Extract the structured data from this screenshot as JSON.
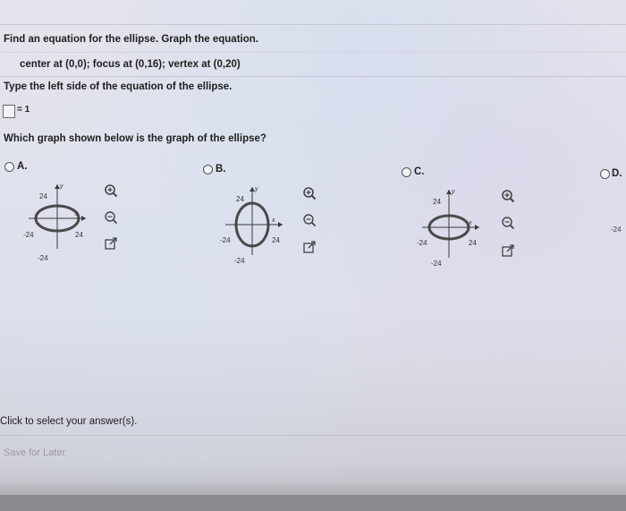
{
  "question": {
    "prompt": "Find an equation for the ellipse. Graph the equation.",
    "given": "center at (0,0); focus at (0,16); vertex at (0,20)",
    "instruction": "Type the left side of the equation of the ellipse.",
    "equation_suffix": "= 1",
    "graph_question": "Which graph shown below is the graph of the ellipse?"
  },
  "options": [
    {
      "letter": "A.",
      "orientation": "horizontal-wide",
      "tick_top": "24",
      "tick_left": "-24",
      "tick_right": "24",
      "tick_bottom": "-24",
      "axis_x": "x",
      "axis_y": "y"
    },
    {
      "letter": "B.",
      "orientation": "vertical",
      "tick_top": "24",
      "tick_left": "-24",
      "tick_right": "24",
      "tick_bottom": "-24",
      "axis_x": "x",
      "axis_y": "y"
    },
    {
      "letter": "C.",
      "orientation": "horizontal",
      "tick_top": "24",
      "tick_left": "-24",
      "tick_right": "24",
      "tick_bottom": "-24",
      "axis_x": "x",
      "axis_y": "y"
    },
    {
      "letter": "D.",
      "tick_right": "-24"
    }
  ],
  "tools": {
    "zoom_in": "magnifier-plus-icon",
    "zoom_out": "magnifier-minus-icon",
    "open": "external-link-icon"
  },
  "footer": {
    "select_text": "Click to select your answer(s).",
    "save_label": "Save for Later"
  },
  "colors": {
    "ellipse_fill": "#5a5a5a",
    "axis": "#3a3a3a",
    "text": "#1f1f1f"
  }
}
